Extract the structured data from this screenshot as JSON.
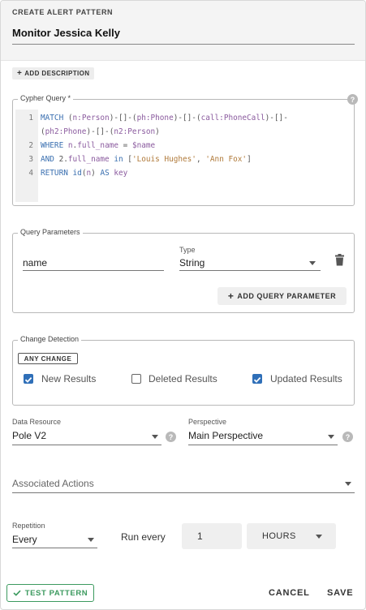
{
  "header": {
    "label": "CREATE ALERT PATTERN",
    "title": "Monitor Jessica Kelly"
  },
  "add_description": {
    "icon": "plus-icon",
    "label": "ADD DESCRIPTION"
  },
  "cypher_query": {
    "legend": "Cypher Query *",
    "line_numbers": [
      "1",
      "2",
      "3",
      "4"
    ],
    "lines": [
      "MATCH (n:Person)-[]-(ph:Phone)-[]-(call:PhoneCall)-[]-",
      "(ph2:Phone)-[]-(n2:Person)",
      "WHERE n.full_name = $name",
      "AND n2.full_name in ['Louis Hughes', 'Ann Fox']",
      "RETURN id(n) AS key"
    ]
  },
  "query_parameters": {
    "legend": "Query Parameters",
    "name_value": "name",
    "type_label": "Type",
    "type_value": "String",
    "add_label": "ADD QUERY PARAMETER"
  },
  "change_detection": {
    "legend": "Change Detection",
    "any_change": "ANY CHANGE",
    "options": [
      {
        "label": "New Results",
        "checked": true
      },
      {
        "label": "Deleted Results",
        "checked": false
      },
      {
        "label": "Updated Results",
        "checked": true
      }
    ]
  },
  "data_resource": {
    "label": "Data Resource",
    "value": "Pole V2"
  },
  "perspective": {
    "label": "Perspective",
    "value": "Main Perspective"
  },
  "associated_actions": {
    "placeholder": "Associated Actions"
  },
  "repetition": {
    "label": "Repetition",
    "value": "Every",
    "run_every_label": "Run every",
    "interval_value": "1",
    "unit_value": "HOURS"
  },
  "footer": {
    "test_label": "TEST PATTERN",
    "cancel_label": "CANCEL",
    "save_label": "SAVE"
  },
  "colors": {
    "accent_blue": "#2f6fb8",
    "test_green": "#3c9a5f"
  }
}
